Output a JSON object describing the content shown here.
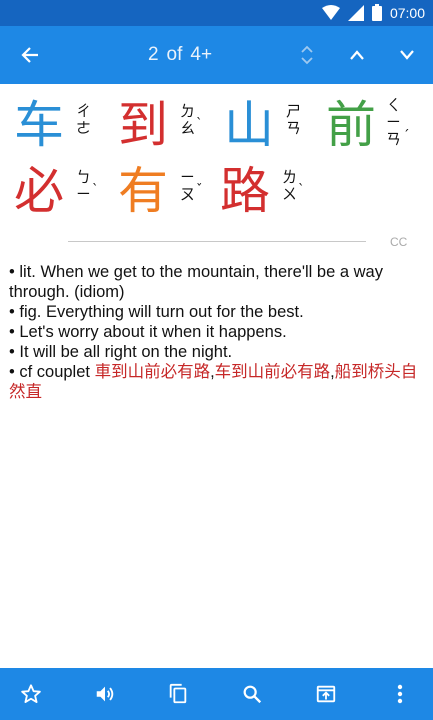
{
  "status": {
    "time": "07:00"
  },
  "appbar": {
    "current": "2",
    "of": "of",
    "total": "4+"
  },
  "chars": [
    {
      "hanzi": "车",
      "zhuyin": [
        "ㄔ",
        "ㄜ"
      ],
      "tone": "",
      "color": "#2a8fd6"
    },
    {
      "hanzi": "到",
      "zhuyin": [
        "ㄉ",
        "ㄠ"
      ],
      "tone": "ˋ",
      "color": "#d32f2f"
    },
    {
      "hanzi": "山",
      "zhuyin": [
        "ㄕ",
        "ㄢ"
      ],
      "tone": "",
      "color": "#2a8fd6"
    },
    {
      "hanzi": "前",
      "zhuyin": [
        "ㄑ",
        "ㄧ",
        "ㄢ"
      ],
      "tone": "ˊ",
      "color": "#43a047"
    },
    {
      "hanzi": "必",
      "zhuyin": [
        "ㄅ",
        "ㄧ"
      ],
      "tone": "ˋ",
      "color": "#d32f2f"
    },
    {
      "hanzi": "有",
      "zhuyin": [
        "ㄧ",
        "ㄡ"
      ],
      "tone": "ˇ",
      "color": "#ef7d22"
    },
    {
      "hanzi": "路",
      "zhuyin": [
        "ㄌ",
        "ㄨ"
      ],
      "tone": "ˋ",
      "color": "#d32f2f"
    }
  ],
  "cc_label": "CC",
  "definitions": {
    "line1": "• lit. When we get to the mountain, there'll be a way through. (idiom)",
    "line2": "• fig. Everything will turn out for the best.",
    "line3": "• Let's worry about it when it happens.",
    "line4": "• It will be all right on the night.",
    "line5_prefix": "• cf couplet ",
    "line5_link1": "車到山前必有路",
    "comma1": ",",
    "line5_link2": "车到山前必有路",
    "comma2": ",",
    "line5_link3": "船到桥头自然直"
  },
  "icons": {
    "back": "arrow-left-icon",
    "sort": "unfold-icon",
    "up": "chevron-up-icon",
    "down": "chevron-down-icon",
    "star": "star-icon",
    "volume": "volume-icon",
    "copy": "copy-icon",
    "search": "search-icon",
    "share": "open-in-icon",
    "more": "more-vert-icon"
  }
}
